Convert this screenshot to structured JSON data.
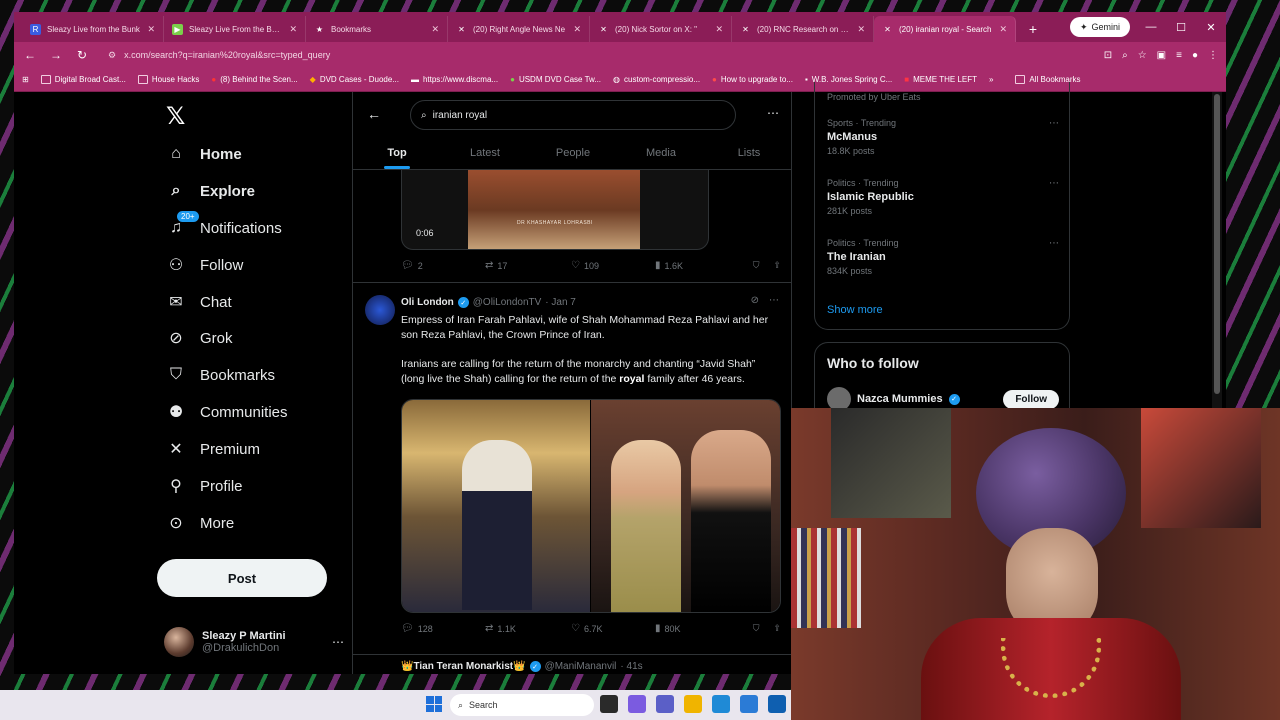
{
  "browser": {
    "tabs": [
      {
        "label": "Sleazy Live from the Bunk",
        "icon": "rumble-r-icon",
        "color": "#3b5ce0"
      },
      {
        "label": "Sleazy Live From the Bunk",
        "icon": "rumble-play-icon",
        "color": "#7bd04a"
      },
      {
        "label": "Bookmarks",
        "icon": "star-icon",
        "color": "#8b1d57"
      },
      {
        "label": "(20) Right Angle News Ne",
        "icon": "x-icon",
        "color": "#111"
      },
      {
        "label": "(20) Nick Sortor on X: \"",
        "icon": "x-icon",
        "color": "#111"
      },
      {
        "label": "(20) RNC Research on X: \"",
        "icon": "x-icon",
        "color": "#111"
      },
      {
        "label": "(20) iranian royal - Search",
        "icon": "x-icon",
        "color": "#111"
      }
    ],
    "active_tab": 6,
    "gemini_label": "Gemini",
    "url": "x.com/search?q=iranian%20royal&src=typed_query",
    "bookmarks": [
      "Digital Broad Cast...",
      "House Hacks",
      "(8) Behind the Scen...",
      "DVD Cases - Duode...",
      "https://www.discma...",
      "USDM DVD Case Tw...",
      "custom-compressio...",
      "How to upgrade to...",
      "W.B. Jones Spring C...",
      "MEME THE LEFT"
    ],
    "all_bookmarks": "All Bookmarks"
  },
  "nav": {
    "items": [
      {
        "label": "Home",
        "icon": "home-icon",
        "glyph": "⌂"
      },
      {
        "label": "Explore",
        "icon": "search-icon",
        "glyph": "⌕"
      },
      {
        "label": "Notifications",
        "icon": "bell-icon",
        "glyph": "🔔︎"
      },
      {
        "label": "Follow",
        "icon": "person-add-icon",
        "glyph": "👤︎"
      },
      {
        "label": "Chat",
        "icon": "mail-icon",
        "glyph": "✉"
      },
      {
        "label": "Grok",
        "icon": "grok-icon",
        "glyph": "⊘"
      },
      {
        "label": "Bookmarks",
        "icon": "bookmark-icon",
        "glyph": "⎕"
      },
      {
        "label": "Communities",
        "icon": "communities-icon",
        "glyph": "👥︎"
      },
      {
        "label": "Premium",
        "icon": "x-icon",
        "glyph": "✕"
      },
      {
        "label": "Profile",
        "icon": "profile-icon",
        "glyph": "👤︎"
      },
      {
        "label": "More",
        "icon": "more-circle-icon",
        "glyph": "⋯"
      }
    ],
    "notif_badge": "20+",
    "post_label": "Post",
    "account": {
      "name": "Sleazy P Martini",
      "handle": "@DrakulichDon"
    }
  },
  "search": {
    "query": "iranian royal",
    "tabs": [
      "Top",
      "Latest",
      "People",
      "Media",
      "Lists"
    ]
  },
  "prev_post": {
    "duration": "0:06",
    "caption": "DR KHASHAYAR LOHRASBI",
    "replies": "2",
    "reposts": "17",
    "likes": "109",
    "views": "1.6K"
  },
  "post": {
    "name": "Oli London",
    "handle": "@OliLondonTV",
    "time": "· Jan 7",
    "text1": "Empress of Iran Farah Pahlavi, wife of Shah Mohammad Reza Pahlavi and her son Reza Pahlavi, the Crown Prince of Iran.",
    "text2_pre": "Iranians are calling for the return of the monarchy and chanting “Javid Shah” (long live the Shah) calling for the return of the ",
    "text2_bold": "royal",
    "text2_post": " family after 46 years.",
    "replies": "128",
    "reposts": "1.1K",
    "likes": "6.7K",
    "views": "80K"
  },
  "post2": {
    "name": "👑Tian Teran Monarkist👑",
    "handle": "@ManiMananvil",
    "time": "· 41s"
  },
  "trends": {
    "promoted": "Promoted by Uber Eats",
    "items": [
      {
        "category": "Sports · Trending",
        "name": "McManus",
        "count": "18.8K posts"
      },
      {
        "category": "Politics · Trending",
        "name": "Islamic Republic",
        "count": "281K posts"
      },
      {
        "category": "Politics · Trending",
        "name": "The Iranian",
        "count": "834K posts"
      }
    ],
    "show_more": "Show more"
  },
  "who_to_follow": {
    "title": "Who to follow",
    "name": "Nazca Mummies",
    "follow_label": "Follow"
  },
  "taskbar": {
    "search_label": "Search"
  },
  "colors": {
    "tabbar": "#8b1d57",
    "toolbar": "#a72b6b",
    "accent": "#1d9bf0"
  }
}
